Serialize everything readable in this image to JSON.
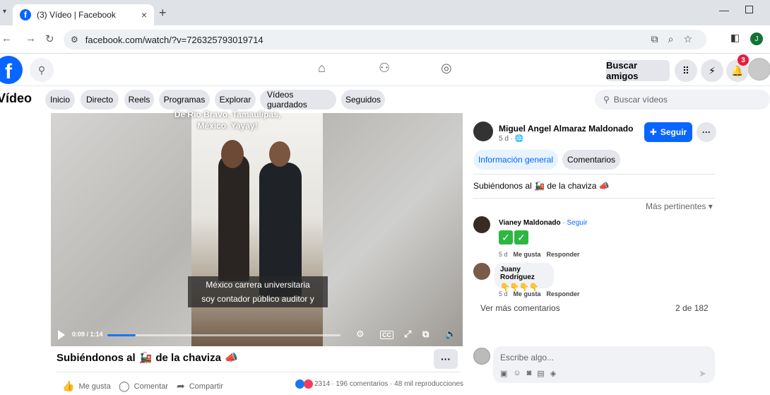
{
  "browser": {
    "tab_title": "(3) Vídeo | Facebook",
    "tab_close": "×",
    "new_tab": "+",
    "url": "facebook.com/watch/?v=726325793019714",
    "profile_initial": "J"
  },
  "header": {
    "logo_letter": "f",
    "find_friends": "Buscar amigos",
    "notification_count": "3"
  },
  "video_bar": {
    "title": "Vídeo",
    "tabs": [
      "Inicio",
      "Directo",
      "Reels",
      "Programas",
      "Explorar",
      "Vídeos guardados",
      "Seguidos"
    ],
    "search_placeholder": "Buscar vídeos"
  },
  "player": {
    "overlay_text": "De Río Bravo, Tamaulipas, México. Yayay!",
    "subtitle_line1": "México carrera universitaria",
    "subtitle_line2": "soy contador público auditor y",
    "time": "0:09 / 1:14",
    "progress": 0.12
  },
  "post": {
    "title": "Subiéndonos al",
    "title_suffix": "de la chaviza",
    "more": "···",
    "actions": {
      "like": "Me gusta",
      "comment": "Comentar",
      "share": "Compartir"
    },
    "reactions_count": "2314",
    "stats": "· 196 comentarios · 48 mil reproducciones"
  },
  "author": {
    "name": "Miguel Angel Almaraz Maldonado",
    "meta": "5 d ·",
    "follow": "Seguir",
    "more": "···"
  },
  "right_tabs": [
    "Información general",
    "Comentarios"
  ],
  "description": "Subiéndonos al",
  "description_suffix": "de la chaviza",
  "sort_label": "Más pertinentes",
  "comments": [
    {
      "name": "Vianey Maldonado",
      "follow": "· Seguir",
      "age": "5 d",
      "like": "Me gusta",
      "reply": "Responder"
    },
    {
      "name": "Juany Rodriguez",
      "age": "5 d",
      "like": "Me gusta",
      "reply": "Responder"
    }
  ],
  "more_comments": "Ver más comentarios",
  "comments_count": "2 de 182",
  "composer_placeholder": "Escribe algo...",
  "colors": {
    "fb_blue": "#0866ff",
    "badge_red": "#e41e3f",
    "check_green": "#2db742"
  }
}
